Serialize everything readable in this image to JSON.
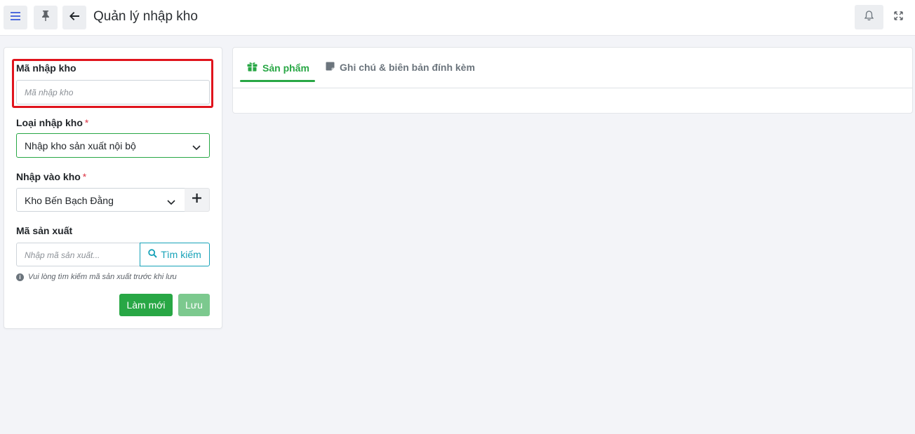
{
  "header": {
    "title": "Quản lý nhập kho"
  },
  "form": {
    "import_code": {
      "label": "Mã nhập kho",
      "placeholder": "Mã nhập kho",
      "value": ""
    },
    "import_type": {
      "label": "Loại nhập kho",
      "required_mark": "*",
      "selected": "Nhập kho sản xuất nội bộ"
    },
    "warehouse": {
      "label": "Nhập vào kho",
      "required_mark": "*",
      "selected": "Kho Bến Bạch Đằng"
    },
    "production_code": {
      "label": "Mã sản xuất",
      "placeholder": "Nhập mã sản xuất...",
      "search_label": "Tìm kiếm",
      "hint": "Vui lòng tìm kiếm mã sản xuất trước khi lưu"
    },
    "actions": {
      "refresh_label": "Làm mới",
      "save_label": "Lưu"
    }
  },
  "tabs": [
    {
      "label": "Sản phẩm",
      "active": true
    },
    {
      "label": "Ghi chú & biên bản đính kèm",
      "active": false
    }
  ],
  "colors": {
    "primary_green": "#28a745",
    "info_cyan": "#17a2b8",
    "highlight_red": "#e0141d",
    "menu_blue": "#4f6bdc"
  }
}
